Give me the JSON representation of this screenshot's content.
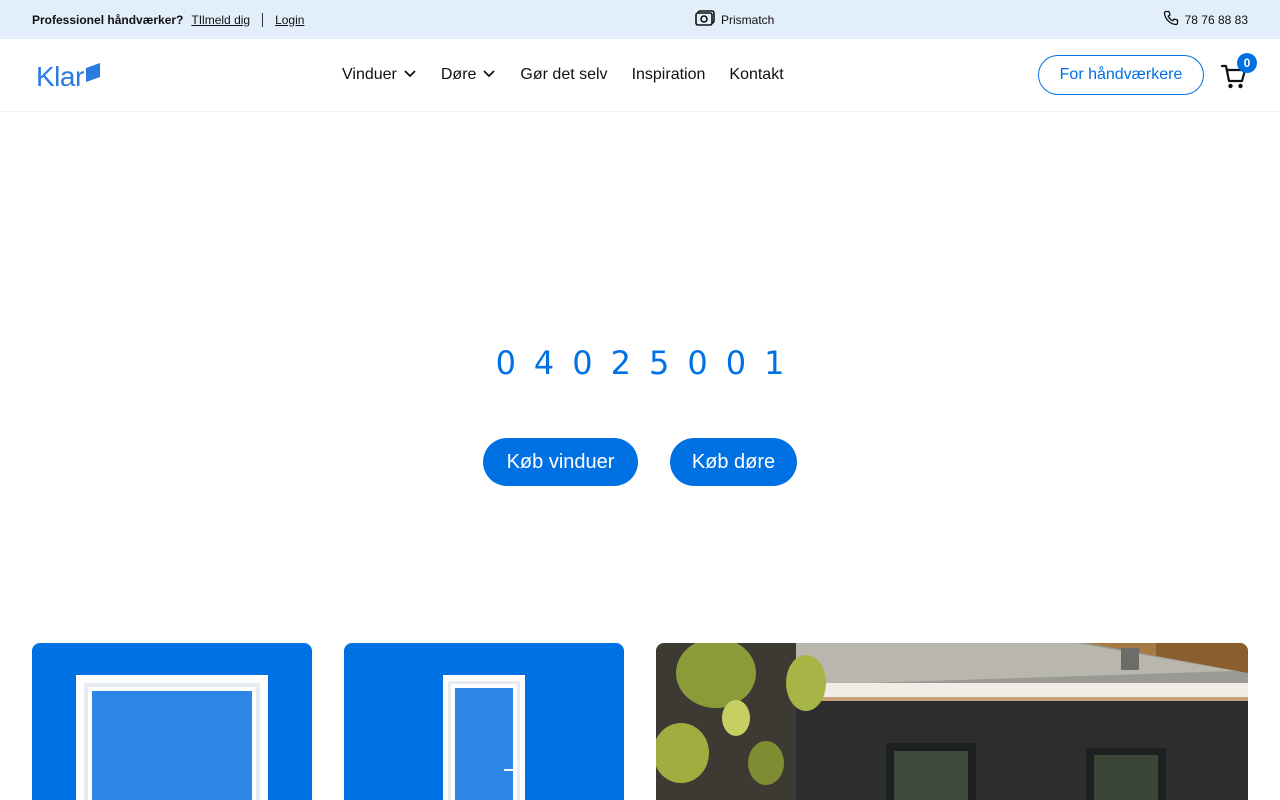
{
  "topbar": {
    "pro_label": "Professionel håndværker?",
    "signup_link": "TIlmeld dig",
    "login_link": "Login",
    "pricematch_label": "Prismatch",
    "phone": "78 76 88 83"
  },
  "header": {
    "logo_text": "Klar",
    "nav": {
      "windows": "Vinduer",
      "doors": "Døre",
      "diy": "Gør det selv",
      "inspiration": "Inspiration",
      "contact": "Kontakt"
    },
    "pro_button": "For håndværkere",
    "cart_count": "0"
  },
  "hero": {
    "number": "04025001",
    "buy_windows": "Køb vinduer",
    "buy_doors": "Køb døre"
  },
  "colors": {
    "brand": "#0071e3",
    "topbar_bg": "#e3eefb"
  },
  "icons": {
    "pricematch": "pricematch-icon",
    "phone": "phone-icon",
    "cart": "cart-icon",
    "chevron": "chevron-down-icon"
  }
}
